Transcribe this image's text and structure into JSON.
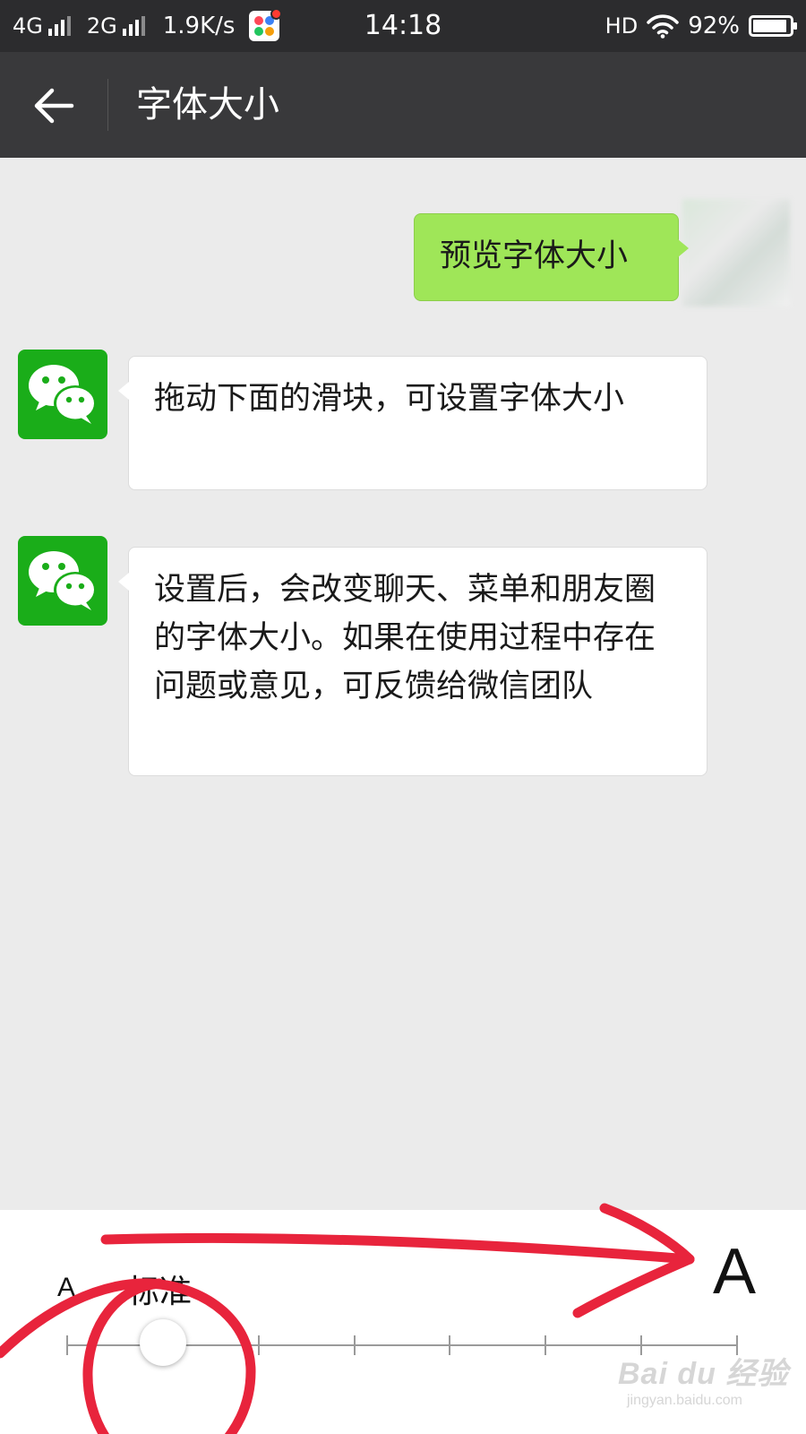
{
  "status_bar": {
    "network_1": "4G",
    "network_2": "2G",
    "speed": "1.9K/s",
    "time": "14:18",
    "hd": "HD",
    "battery": "92%",
    "battery_level": 0.92
  },
  "header": {
    "title": "字体大小"
  },
  "chat": {
    "messages": [
      {
        "side": "right",
        "text": "预览字体大小"
      },
      {
        "side": "left",
        "text": "拖动下面的滑块，可设置字体大小"
      },
      {
        "side": "left",
        "text": "设置后，会改变聊天、菜单和朋友圈的字体大小。如果在使用过程中存在问题或意见，可反馈给微信团队"
      }
    ]
  },
  "font_slider": {
    "small_label": "A",
    "large_label": "A",
    "current_label": "标准",
    "steps": 8,
    "selected_step": 2
  },
  "watermark": {
    "brand": "Bai du 经验",
    "sub": "jingyan.baidu.com"
  },
  "colors": {
    "annotation": "#e8243c",
    "wechat_green": "#1aad19",
    "bubble_green": "#9fe658"
  }
}
